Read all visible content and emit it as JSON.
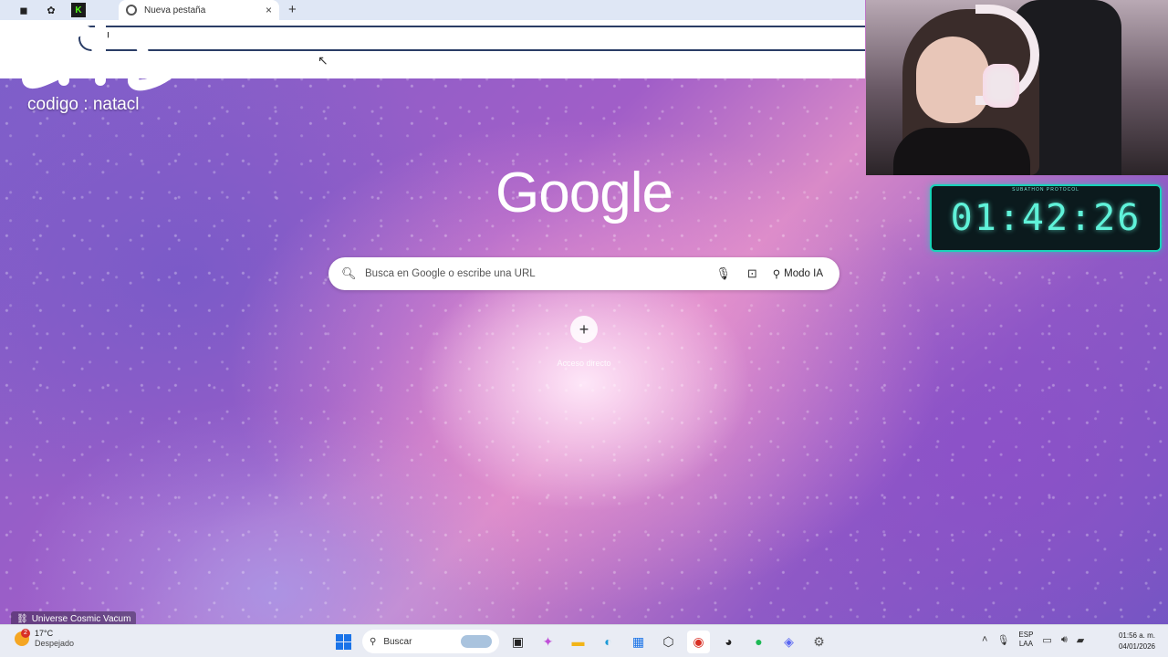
{
  "browser": {
    "tab_title": "Nueva pestaña",
    "tab_close": "×",
    "new_tab": "+",
    "pinned_icons": [
      "app-icon",
      "gear-app-icon",
      "kick-icon"
    ]
  },
  "overlay": {
    "stream_code": "codigo : natacl",
    "timer_label": "SUBATHON PROTOCOL",
    "timer": "01:42:26"
  },
  "ntp": {
    "logo": "Google",
    "search_placeholder": "Busca en Google o escribe una URL",
    "ai_mode_label": "Modo IA",
    "shortcut_add": "+",
    "shortcut_label": "Acceso directo",
    "background_credit": "Universe Cosmic Vacum"
  },
  "taskbar": {
    "weather_temp": "17°C",
    "weather_condition": "Despejado",
    "weather_badge": "2",
    "search_label": "Buscar",
    "lang_1": "ESP",
    "lang_2": "LAA",
    "time": "01:56 a. m.",
    "date": "04/01/2026"
  },
  "colors": {
    "timer_accent": "#18d3b8",
    "windows_blue": "#1a73e8"
  }
}
